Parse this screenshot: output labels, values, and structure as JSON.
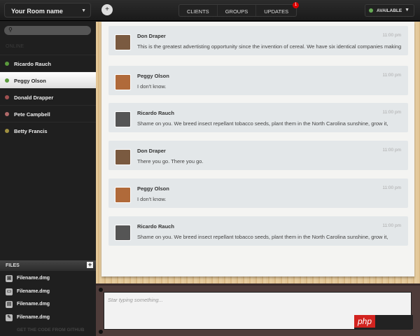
{
  "header": {
    "room_name": "Your Room name",
    "tabs": [
      {
        "label": "CLIENTS"
      },
      {
        "label": "GROUPS"
      },
      {
        "label": "UPDATES",
        "badge": "1"
      }
    ],
    "status": "AVAILABLE"
  },
  "sidebar": {
    "online_label": "ONLINE",
    "users": [
      {
        "name": "Ricardo Rauch",
        "color": "#5a9a3c"
      },
      {
        "name": "Peggy Olson",
        "color": "#5a9a3c"
      },
      {
        "name": "Donald Drapper",
        "color": "#a05050"
      },
      {
        "name": "Pete Campbell",
        "color": "#b06a6a"
      },
      {
        "name": "Betty Francis",
        "color": "#a09040"
      }
    ],
    "selected": "Peggy Olson"
  },
  "files": {
    "title": "FILES",
    "items": [
      "Filename.dmg",
      "Filename.dmg",
      "Filename.dmg",
      "Filename.dmg"
    ],
    "footer": "GET THE CODE FROM GITHUB"
  },
  "messages": [
    {
      "name": "Don Draper",
      "time": "11:00 pm",
      "text": "This is the greatest advertisting opportunity since the invention of cereal. We have six identical companies making"
    },
    {
      "name": "Peggy Olson",
      "time": "11:00 pm",
      "text": "I don't know."
    },
    {
      "name": "Ricardo Rauch",
      "time": "11:00 pm",
      "text": "Shame on you. We breed insect repellant tobacco seeds, plant them in the North Carolina sunshine, grow it,"
    },
    {
      "name": "Don Draper",
      "time": "11:00 pm",
      "text": "There you go. There you go."
    },
    {
      "name": "Peggy Olson",
      "time": "11:00 pm",
      "text": "I don't know."
    },
    {
      "name": "Ricardo Rauch",
      "time": "11:00 pm",
      "text": "Shame on you. We breed insect repellant tobacco seeds, plant them in the North Carolina sunshine, grow it,"
    }
  ],
  "composer": {
    "placeholder": "Star typing something..."
  },
  "watermark": "php"
}
